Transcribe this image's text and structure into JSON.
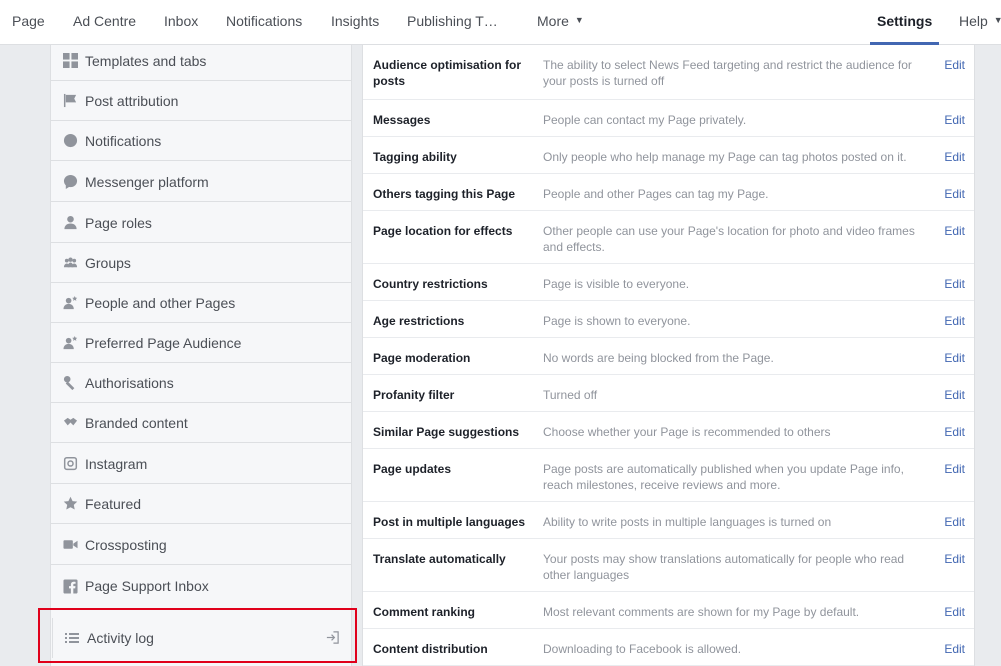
{
  "nav": {
    "items": [
      "Page",
      "Ad Centre",
      "Inbox",
      "Notifications",
      "Insights",
      "Publishing T…",
      "More"
    ],
    "settings": "Settings",
    "help": "Help"
  },
  "sidebar": {
    "items": [
      {
        "label": "Templates and tabs",
        "icon": "grid-icon"
      },
      {
        "label": "Post attribution",
        "icon": "flag-icon"
      },
      {
        "label": "Notifications",
        "icon": "globe-icon"
      },
      {
        "label": "Messenger platform",
        "icon": "messenger-icon"
      },
      {
        "label": "Page roles",
        "icon": "person-icon"
      },
      {
        "label": "Groups",
        "icon": "group-icon"
      },
      {
        "label": "People and other Pages",
        "icon": "person-star-icon"
      },
      {
        "label": "Preferred Page Audience",
        "icon": "person-star-icon"
      },
      {
        "label": "Authorisations",
        "icon": "wrench-icon"
      },
      {
        "label": "Branded content",
        "icon": "handshake-icon"
      },
      {
        "label": "Instagram",
        "icon": "instagram-icon"
      },
      {
        "label": "Featured",
        "icon": "star-icon"
      },
      {
        "label": "Crossposting",
        "icon": "video-icon"
      },
      {
        "label": "Page Support Inbox",
        "icon": "facebook-icon"
      }
    ],
    "activity_log": "Activity log"
  },
  "settings": {
    "edit_label": "Edit",
    "rows": [
      {
        "label": "Audience optimisation for posts",
        "desc": "The ability to select News Feed targeting and restrict the audience for your posts is turned off"
      },
      {
        "label": "Messages",
        "desc": "People can contact my Page privately."
      },
      {
        "label": "Tagging ability",
        "desc": "Only people who help manage my Page can tag photos posted on it."
      },
      {
        "label": "Others tagging this Page",
        "desc": "People and other Pages can tag my Page."
      },
      {
        "label": "Page location for effects",
        "desc": "Other people can use your Page's location for photo and video frames and effects."
      },
      {
        "label": "Country restrictions",
        "desc": "Page is visible to everyone."
      },
      {
        "label": "Age restrictions",
        "desc": "Page is shown to everyone."
      },
      {
        "label": "Page moderation",
        "desc": "No words are being blocked from the Page."
      },
      {
        "label": "Profanity filter",
        "desc": "Turned off"
      },
      {
        "label": "Similar Page suggestions",
        "desc": "Choose whether your Page is recommended to others"
      },
      {
        "label": "Page updates",
        "desc": "Page posts are automatically published when you update Page info, reach milestones, receive reviews and more."
      },
      {
        "label": "Post in multiple languages",
        "desc": "Ability to write posts in multiple languages is turned on"
      },
      {
        "label": "Translate automatically",
        "desc": "Your posts may show translations automatically for people who read other languages"
      },
      {
        "label": "Comment ranking",
        "desc": "Most relevant comments are shown for my Page by default."
      },
      {
        "label": "Content distribution",
        "desc": "Downloading to Facebook is allowed."
      }
    ]
  }
}
